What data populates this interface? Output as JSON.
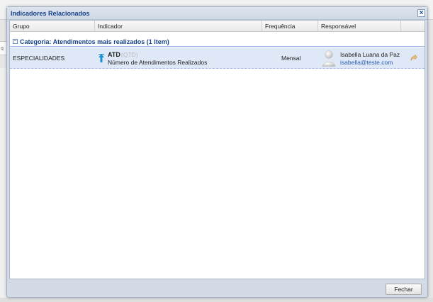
{
  "background": {
    "left_fragment": "q"
  },
  "dialog": {
    "title": "Indicadores Relacionados",
    "close_glyph": "×"
  },
  "grid": {
    "columns": [
      "Grupo",
      "Indicador",
      "Frequência",
      "Responsável"
    ],
    "group": {
      "expander_glyph": "−",
      "label": "Categoria: Atendimentos mais realizados (1 Item)"
    },
    "rows": [
      {
        "grupo": "ESPECIALIDADES",
        "indicador_code": "ATD",
        "indicador_unit": "(QTD)",
        "indicador_name": "Número de Atendimentos Realizados",
        "frequencia": "Mensal",
        "responsavel_name": "Isabella Luana da Paz",
        "responsavel_email": "isabella@teste.com",
        "trend_icon": "arrow-up-icon",
        "action_icon": "arrow-share-icon"
      }
    ]
  },
  "footer": {
    "close_label": "Fechar"
  },
  "colors": {
    "accent": "#15428b",
    "row_selected": "#dfe8f6",
    "trend": "#1a8fd8",
    "action": "#d9a25a"
  }
}
